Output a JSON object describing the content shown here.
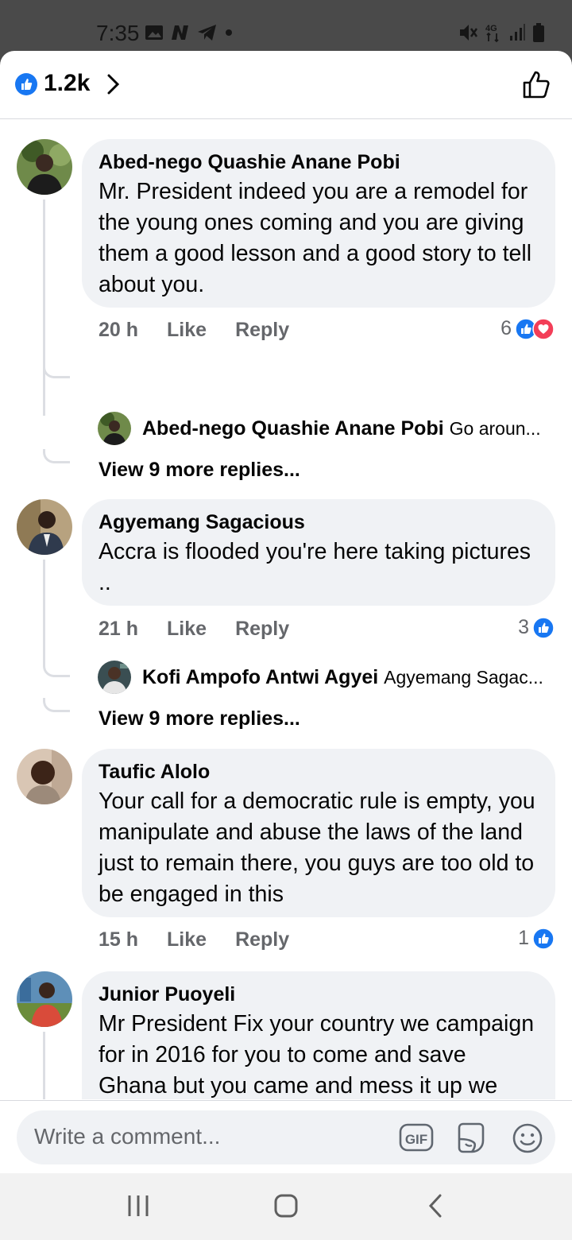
{
  "status_bar": {
    "time": "7:35"
  },
  "header": {
    "reaction_count": "1.2k"
  },
  "comments": [
    {
      "author": "Abed-nego Quashie Anane Pobi",
      "text": "Mr. President indeed you are a remodel for the young ones coming and you are giving them a good lesson and a good story to tell about you.",
      "time": "20 h",
      "like_label": "Like",
      "reply_label": "Reply",
      "reactions": "6",
      "reply_author": "Abed-nego Quashie Anane Pobi",
      "reply_preview": "Go aroun...",
      "view_more": "View 9 more replies..."
    },
    {
      "author": "Agyemang Sagacious",
      "text": "Accra is flooded you're here taking pictures ..",
      "time": "21 h",
      "like_label": "Like",
      "reply_label": "Reply",
      "reactions": "3",
      "reply_author": "Kofi Ampofo Antwi Agyei",
      "reply_preview": "Agyemang Sagac...",
      "view_more": "View 9 more replies..."
    },
    {
      "author": "Taufic Alolo",
      "text": "Your call for a democratic rule is empty, you manipulate and abuse the laws of the land just to remain there, you guys are too old to be engaged in this",
      "time": "15 h",
      "like_label": "Like",
      "reply_label": "Reply",
      "reactions": "1"
    },
    {
      "author": "Junior Puoyeli",
      "text": "Mr President Fix your country we campaign for in 2016 for you to come and save Ghana but you came and mess it up we need a good change from you we don't need a culture of silence"
    }
  ],
  "composer": {
    "placeholder": "Write a comment...",
    "gif_label": "GIF"
  },
  "colors": {
    "accent": "#1877f2",
    "love": "#f33e58",
    "bubble": "#f0f2f5",
    "meta_text": "#65676b"
  }
}
